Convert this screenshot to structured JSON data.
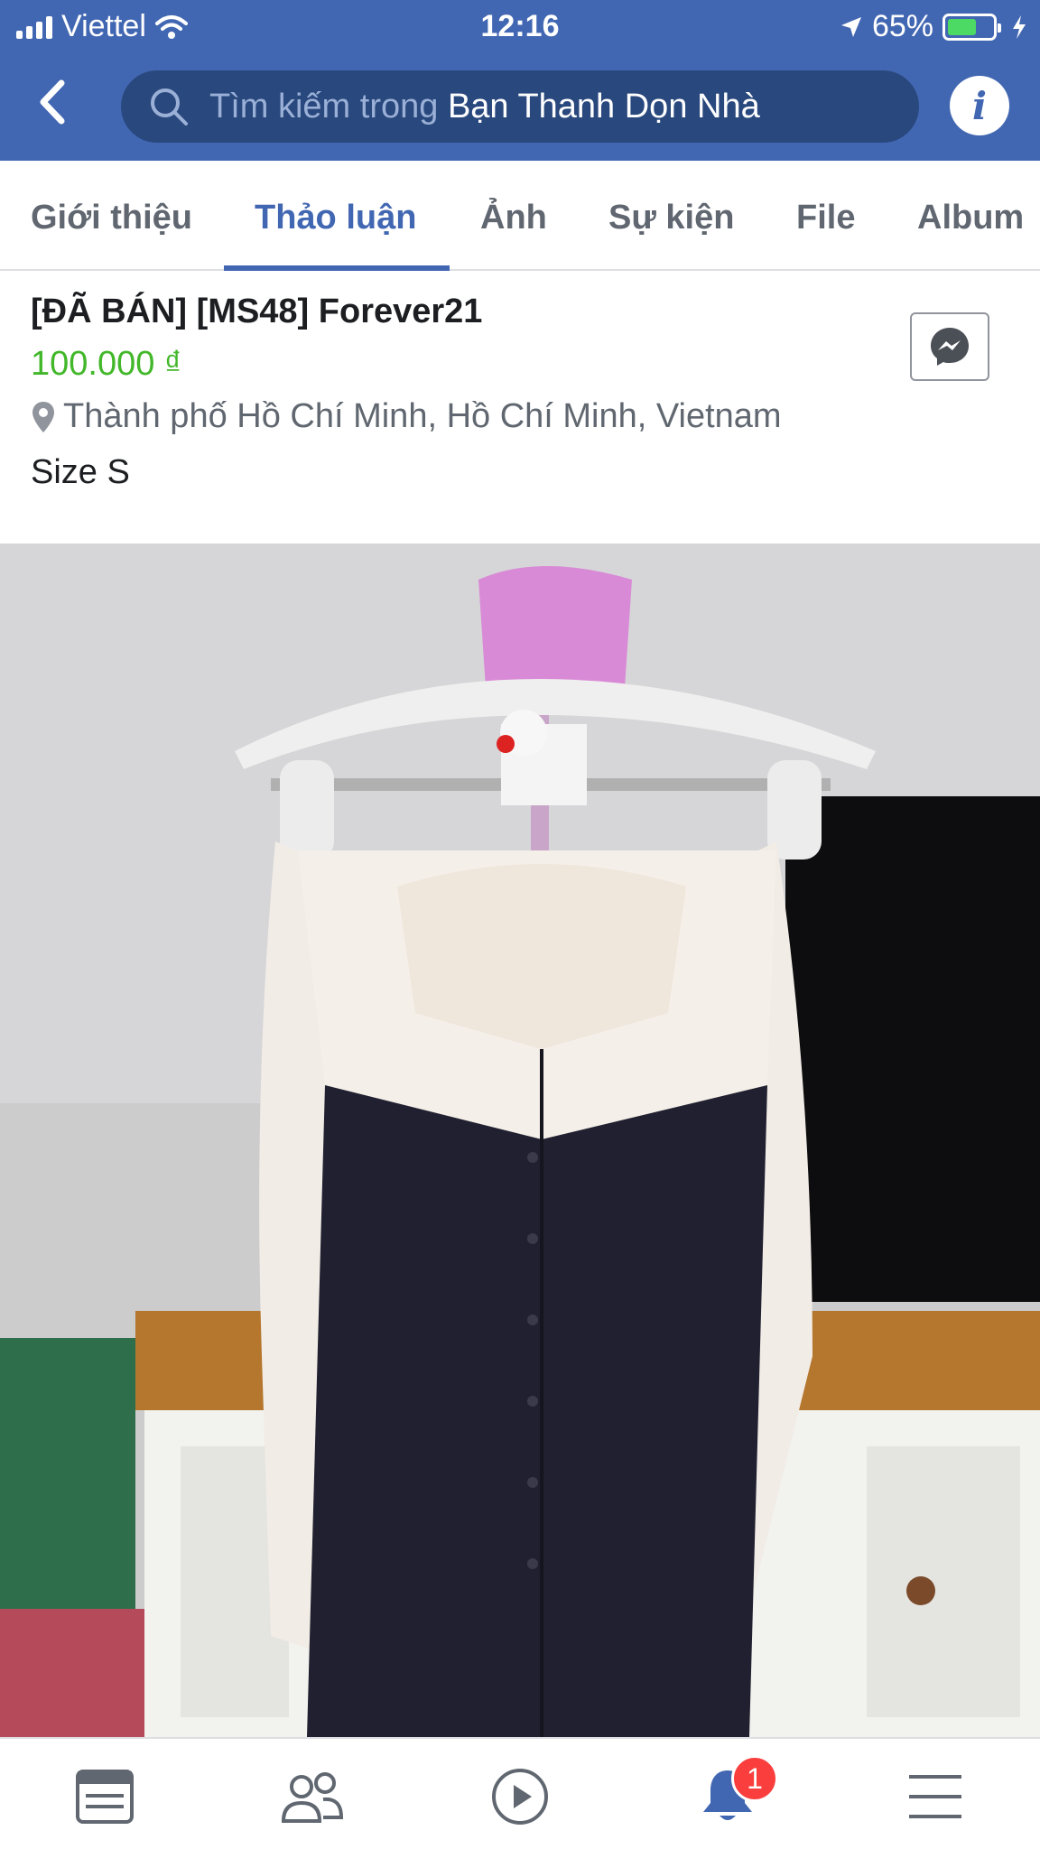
{
  "status_bar": {
    "carrier": "Viettel",
    "time": "12:16",
    "battery_percent": "65%",
    "battery_level": 0.65,
    "icons": [
      "signal-icon",
      "wifi-icon",
      "location-arrow-icon",
      "battery-icon",
      "charging-icon"
    ]
  },
  "header": {
    "search_placeholder": "Tìm kiếm trong",
    "search_group": "Bạn Thanh Dọn Nhà",
    "icons": [
      "back-icon",
      "search-icon",
      "info-icon"
    ]
  },
  "tabs": [
    {
      "label": "Giới thiệu",
      "active": false
    },
    {
      "label": "Thảo luận",
      "active": true
    },
    {
      "label": "Ảnh",
      "active": false
    },
    {
      "label": "Sự kiện",
      "active": false
    },
    {
      "label": "File",
      "active": false
    },
    {
      "label": "Album",
      "active": false
    }
  ],
  "post": {
    "title": "[ĐÃ BÁN] [MS48] Forever21",
    "price": "100.000 ₫",
    "location": "Thành phố Hồ Chí Minh, Hồ Chí Minh, Vietnam",
    "description": "Size S",
    "icons": [
      "location-pin-icon",
      "messenger-icon"
    ]
  },
  "bottom_nav": {
    "items": [
      "news-feed-icon",
      "groups-icon",
      "watch-icon",
      "notifications-icon",
      "menu-icon"
    ],
    "notification_badge": "1"
  },
  "colors": {
    "brand": "#4267b2",
    "search_bg": "#29487d",
    "price_green": "#42b72a",
    "badge_red": "#fa3e3e"
  }
}
